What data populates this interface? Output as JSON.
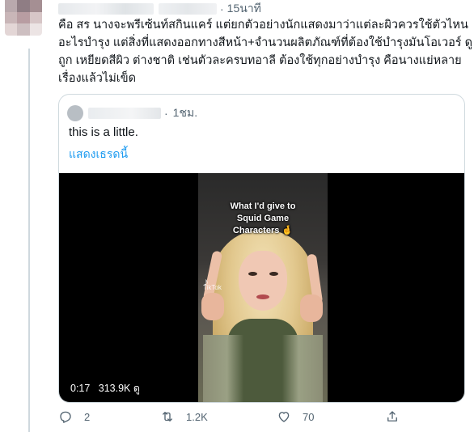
{
  "tweet": {
    "time": "15นาที",
    "text_lines": [
      "คือ สร นางจะพรีเซ้นท์สกินแคร์ แต่ยกตัวอย่างนักแสดงมาว่าแต่ละผิวควรใช้ตัวไหน",
      "อะไรบำรุง แต่สิ่งที่แสดงออกทางสีหน้า+จำนวนผลิตภัณฑ์ที่ต้องใช้บำรุงมันโอเวอร์ ดู",
      "ถูก เหยียดสีผิว ต่างชาติ เช่นตัวละครบทอาลี ต้องใช้ทุกอย่างบำรุง คือนางแย่หลาย",
      "เรื่องแล้วไม่เข็ด"
    ]
  },
  "quote": {
    "time": "1ชม.",
    "text": "this is a little.",
    "show_thread": "แสดงเธรดนี้",
    "video": {
      "caption_lines": [
        "What I'd give to",
        "Squid Game",
        "Characters 🤞"
      ],
      "watermark": "TikTok",
      "duration": "0:17",
      "views": "313.9K ดู"
    }
  },
  "actions": {
    "reply_count": "2",
    "retweet_count": "1.2K",
    "like_count": "70"
  },
  "colors": {
    "link": "#1d9bf0",
    "muted": "#536471",
    "border": "#cfd9de"
  }
}
